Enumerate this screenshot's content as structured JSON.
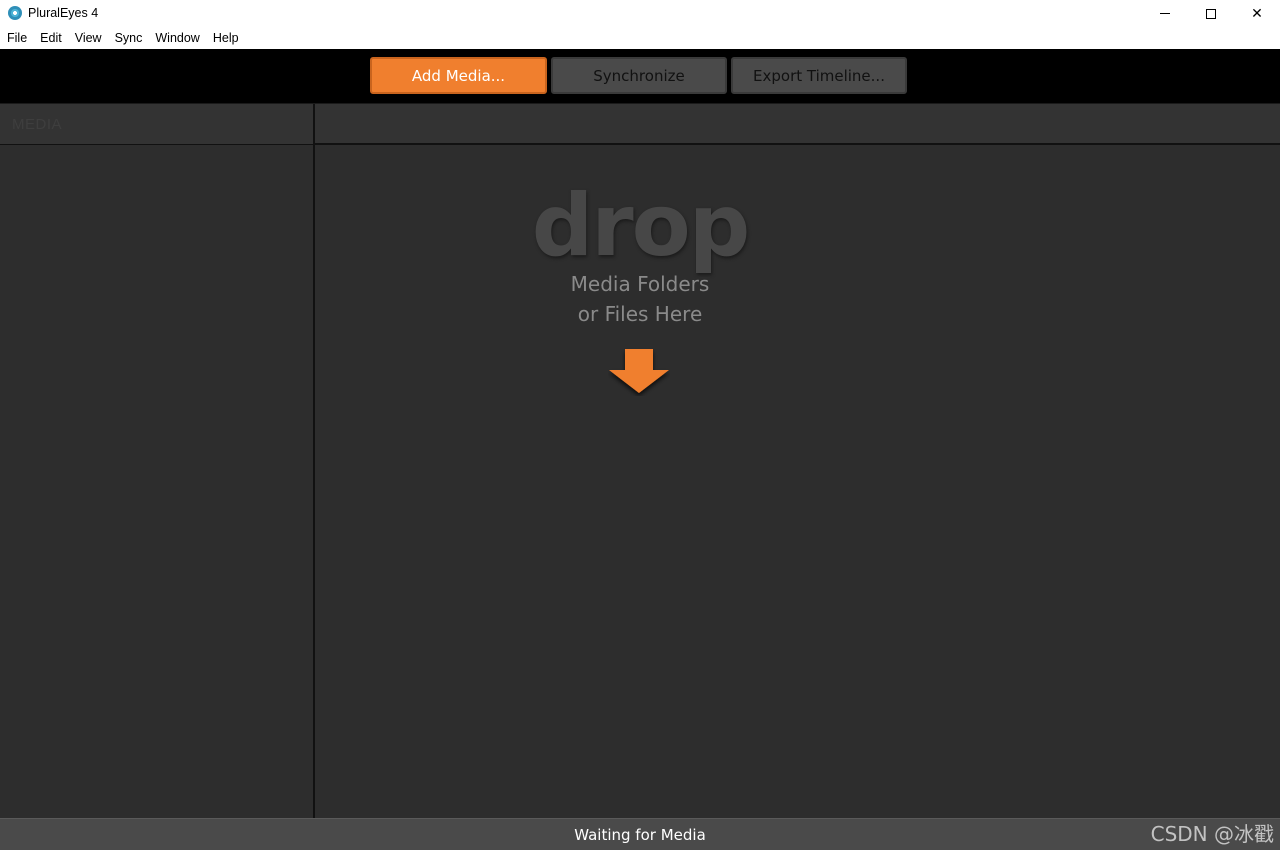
{
  "window": {
    "title": "PluralEyes 4",
    "icon": "pluraleyes-logo-icon",
    "controls": {
      "minimize": "minimize-icon",
      "maximize": "maximize-icon",
      "close": "close-icon",
      "close_glyph": "✕"
    }
  },
  "menu": {
    "items": [
      {
        "label": "File"
      },
      {
        "label": "Edit"
      },
      {
        "label": "View"
      },
      {
        "label": "Sync"
      },
      {
        "label": "Window"
      },
      {
        "label": "Help"
      }
    ]
  },
  "toolbar": {
    "add_media_label": "Add Media...",
    "synchronize_label": "Synchronize",
    "export_timeline_label": "Export Timeline..."
  },
  "media_panel": {
    "header_label": "MEDIA"
  },
  "drop_zone": {
    "headline": "drop",
    "line1": "Media Folders",
    "line2": "or Files Here",
    "arrow_icon": "down-arrow-icon"
  },
  "status": {
    "text": "Waiting for Media"
  },
  "watermark": {
    "text": "CSDN @冰戳"
  },
  "colors": {
    "accent": "#f07f2e",
    "toolbar_bg": "#000000",
    "panel_bg": "#2d2d2d",
    "status_bg": "#4a4a4a"
  }
}
